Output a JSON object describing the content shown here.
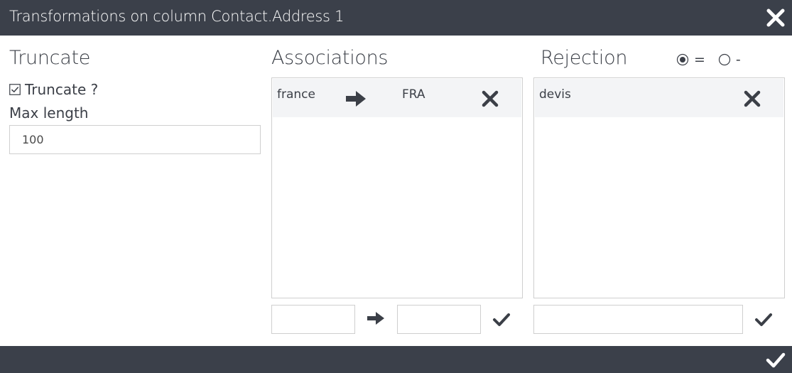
{
  "window": {
    "title": "Transformations on column Contact.Address 1",
    "close_icon": "close-icon",
    "confirm_icon": "check-icon"
  },
  "truncate": {
    "heading": "Truncate",
    "checkbox_label": "Truncate ?",
    "checked": true,
    "max_length_label": "Max length",
    "max_length_value": "100"
  },
  "associations": {
    "heading": "Associations",
    "rows": [
      {
        "from": "france",
        "to": "FRA",
        "arrow_icon": "arrow-right-icon",
        "delete_icon": "close-icon"
      }
    ],
    "new_from_value": "",
    "new_to_value": "",
    "add_icon": "check-icon"
  },
  "rejection": {
    "heading": "Rejection",
    "mode_options": [
      {
        "label": "=",
        "selected": true
      },
      {
        "label": "-",
        "selected": false
      }
    ],
    "rows": [
      {
        "value": "devis",
        "delete_icon": "close-icon"
      }
    ],
    "new_value": "",
    "add_icon": "check-icon"
  },
  "colors": {
    "bar": "#3b404a",
    "text": "#3b3f47",
    "row_bg": "#f3f4f6",
    "border": "#cfcfcf"
  }
}
